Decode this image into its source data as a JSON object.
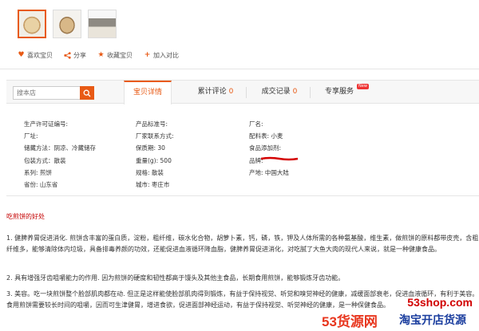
{
  "thumbnails": [
    {
      "icon": "flatbread-stack-image"
    },
    {
      "icon": "flatbread-plate-image"
    },
    {
      "icon": "flatbread-pan-image"
    }
  ],
  "actions": [
    {
      "label": "喜欢宝贝",
      "icon": "heart-icon"
    },
    {
      "label": "分享",
      "icon": "share-icon"
    },
    {
      "label": "收藏宝贝",
      "icon": "star-icon"
    },
    {
      "label": "加入对比",
      "icon": "plus-icon"
    }
  ],
  "search": {
    "placeholder": "搜本店"
  },
  "tabs": [
    {
      "label": "宝贝详情",
      "count": ""
    },
    {
      "label": "累计评论",
      "count": "0"
    },
    {
      "label": "成交记录",
      "count": "0"
    },
    {
      "label": "专享服务",
      "count": "",
      "badge": "New"
    }
  ],
  "attributes": {
    "col1": [
      "生产许可证编号:",
      "厂址:",
      "储藏方法：阴凉、冷藏储存",
      "包装方式：散装",
      "系列: 煎饼",
      "省份: 山东省"
    ],
    "col2": [
      "产品标准号:",
      "厂家联系方式:",
      "保质期: 30",
      "重量(g): 500",
      "规格: 散装",
      "城市: 枣庄市"
    ],
    "col3": [
      "厂名:",
      "配料表: 小麦",
      "食品添加剂:",
      "品牌: ",
      "产地: 中国大陆"
    ]
  },
  "description": {
    "title": "吃煎饼的好处",
    "p1": "1. 健脾养胃促进消化. 煎饼含丰富的蛋白质，淀粉，粗纤维，碳水化合物，胡萝卜素，钙，磷，铁，钾及人体所需的各种氨基酸，维生素，做煎饼的原料都带皮壳，含粗纤维多，能够清除体内垃圾，具备排毒养颜的功效，还能促进血液循环降血脂，健脾养胃促进消化，对吃腻了大鱼大肉的现代人来说，就是一种健康食品。",
    "p2": "2. 具有增强牙齿咀嚼能力的作用. 因为煎饼的硬度和韧性都高于馒头及其他主食品，长期食用煎饼，能够锻炼牙齿功能。",
    "p3": "3. 美容。吃一块煎饼整个脸部肌肉都在动. 但正是这样能使脸部肌肉得到锻炼，有益于保持视觉、听觉和嗅觉神经的健康，减缓面部衰老，促进血液循环，有利于美容。食用煎饼需要较长时间的咀嚼，因而可生津健胃，增进食欲，促进面部神经运动，有益于保持视觉、听觉神经的健康，是一种保健食品。"
  },
  "watermark": {
    "url": "53shop.com",
    "brand": "53货源网",
    "slogan": "淘宝开店货源"
  },
  "colors": {
    "accent": "#e85a15",
    "title_red": "#c40000"
  }
}
